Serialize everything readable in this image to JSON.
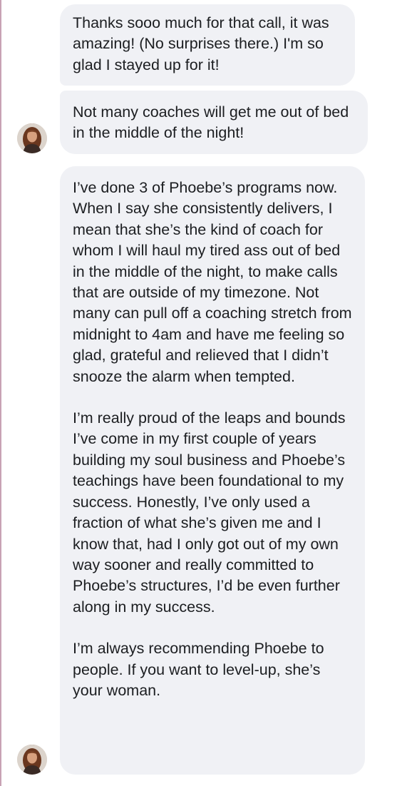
{
  "conversation": {
    "messages": [
      {
        "paragraphs": [
          "Thanks sooo much for that call, it was amazing! (No surprises there.) I'm so glad I stayed up for it!"
        ]
      },
      {
        "paragraphs": [
          "Not many coaches will get me out of bed in the middle of the night!"
        ]
      },
      {
        "paragraphs": [
          "I’ve done 3 of Phoebe’s programs now. When I say she consistently delivers, I mean that she’s the kind of coach for whom I will haul my tired ass out of bed in the middle of the night, to make calls that are outside of my timezone. Not many can pull off a coaching stretch from midnight to 4am and have me feeling so glad, grateful and relieved that I didn’t snooze the alarm when tempted.",
          "I’m really proud of the leaps and bounds I’ve come in my first couple of years building my soul business and Phoebe’s teachings have been foundational to my success. Honestly, I’ve only used a fraction of what she’s given me and I know that, had I only got out of my own way sooner and really committed to Phoebe’s structures, I’d be even further along in my success.",
          "I’m always recommending Phoebe to people. If you want to level-up, she’s your woman."
        ]
      }
    ]
  },
  "colors": {
    "bubble_background": "#f0f1f5",
    "text": "#1c1e21",
    "page_background": "#ffffff",
    "left_edge_accent": "#c8a2b4"
  },
  "icons": {
    "avatar": "sender-avatar-photo"
  }
}
